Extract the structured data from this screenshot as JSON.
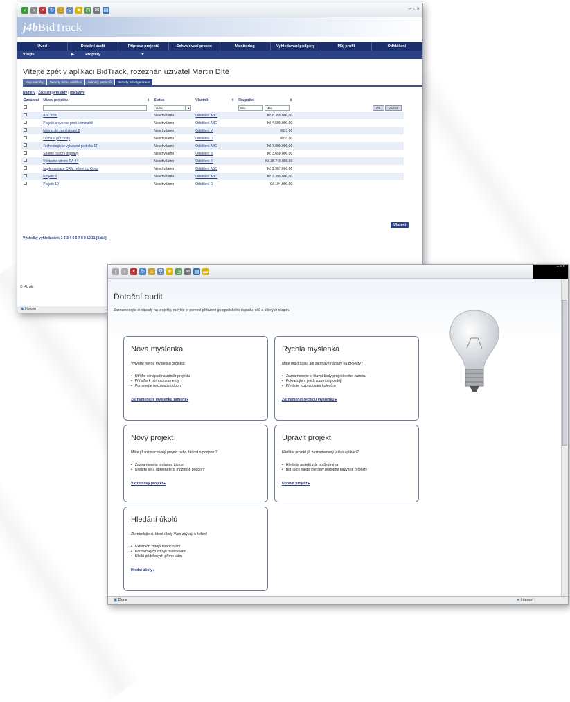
{
  "w1": {
    "logo": "j4b",
    "logo_rest": "BidTrack",
    "nav": [
      "Úvod",
      "Dotační audit",
      "Příprava projektů",
      "Schvalovací proces",
      "Monitoring",
      "Vyhledávání podpory",
      "Můj profil",
      "Odhlášení"
    ],
    "nav2": [
      "Vítejte",
      "Projekty"
    ],
    "welcome": "Vítejte zpět v aplikaci BidTrack, rozeznán uživatel Martin Dítě",
    "tabs": [
      "Moje náměty",
      "Náměty mého oddělení",
      "Náměty partnerů",
      "Náměty mé organizace"
    ],
    "sub": [
      "Náměty",
      "Žádosti",
      "Projekty",
      "Iniciativy"
    ],
    "cols": [
      "Označení",
      "Název projektu",
      "Status",
      "Vlastník",
      "Rozpočet"
    ],
    "filter": {
      "status": "(Vše)",
      "min": "Min",
      "max": "Max",
      "ok": "OK",
      "clear": "Vyčistit"
    },
    "rows": [
      [
        "ABC club",
        "Neschváleno",
        "Oddělení ABC",
        "Kč 6.350.000,00"
      ],
      [
        "Projekt prevence proti kriminalitě",
        "Neschváleno",
        "Oddělení ABC",
        "Kč 4.500.000,00"
      ],
      [
        "Návrat do zaměstnání 2",
        "Neschváleno",
        "Oddělení V",
        "Kč 0,00"
      ],
      [
        "Dům na půl cesty",
        "Neschváleno",
        "Oddělení D",
        "Kč 0,00"
      ],
      [
        "Technologické vybavení podniku EF",
        "Neschváleno",
        "Oddělení ABC",
        "Kč 7.000.000,00"
      ],
      [
        "Sdílení osobní dopravy",
        "Neschváleno",
        "Oddělení M",
        "Kč 3.650.000,00"
      ],
      [
        "Výstavba silnice RA 44",
        "Neschváleno",
        "Oddělení M",
        "Kč 38.740.000,00"
      ],
      [
        "Implementace CRM řešení do Obce",
        "Neschváleno",
        "Oddělení ABC",
        "Kč 2.967.000,00"
      ],
      [
        "Projekt 9",
        "Neschváleno",
        "Oddělení ABC",
        "Kč 2.390.000,00"
      ],
      [
        "Projekt 10",
        "Neschváleno",
        "Oddělení D",
        "Kč 194.000,00"
      ]
    ],
    "save": "Uloženi",
    "pages_label": "Výsledky vyhledávání:",
    "pages": "1 2 3 4 5 6 7 8 9 10 11",
    "all": "[Ilabíl]",
    "footer": "© j4b plc",
    "status": "Hotovo"
  },
  "w2": {
    "title": "Dotační audit",
    "intro": "Zaznamenejte si nápady na projekty, rozvíjte je pomocí přiřazení geografického dopadu, cílů a cílových skupin.",
    "cards": [
      {
        "title": "Nová myšlenka",
        "text": "Vytvořte novou myšlenku projektu",
        "items": [
          "Utřiďte si nápad na záměr projektu",
          "Přiřaďte k němu dokumenty",
          "Porovnejte možnosti podpory"
        ],
        "link": "Zaznamenejte myšlenku záměru"
      },
      {
        "title": "Rychlá myšlenka",
        "text": "Máte málo času, ale zajímavé nápady na projekty?",
        "items": [
          "Zaznamenejte si hlavní body projektového záměru",
          "Pokračujte v jejich rozvinutí později",
          "Předejte rozpracování kolegům"
        ],
        "link": "Zaznamenat rychlou myšlenku"
      },
      {
        "title": "Nový projekt",
        "text": "Máte již rozpracovaný projekt nebo žádost o podporu?",
        "items": [
          "Zaznamenejte podanou žádost",
          "Ujistěte se a upřesněte si možnosti podpory"
        ],
        "link": "Vložit nový projekt"
      },
      {
        "title": "Upravit projekt",
        "text": "Hledáte projekt již zaznamenaný v této aplikaci?",
        "items": [
          "Hledejte projekt zde podle jména",
          "BidTrack najde všechny podobně nazvané projekty"
        ],
        "link": "Upravit projekt"
      },
      {
        "title": "Hledání úkolů",
        "text": "Zkontrolujte si, které úkoly Vám zbývají k řešení",
        "items": [
          "Externích zdrojů financování",
          "Partnerských zdrojů financování",
          "Úkolů přidělených přímo Vám"
        ],
        "link": "Hledat úkoly"
      }
    ],
    "status": "Done",
    "zone": "Internet"
  }
}
